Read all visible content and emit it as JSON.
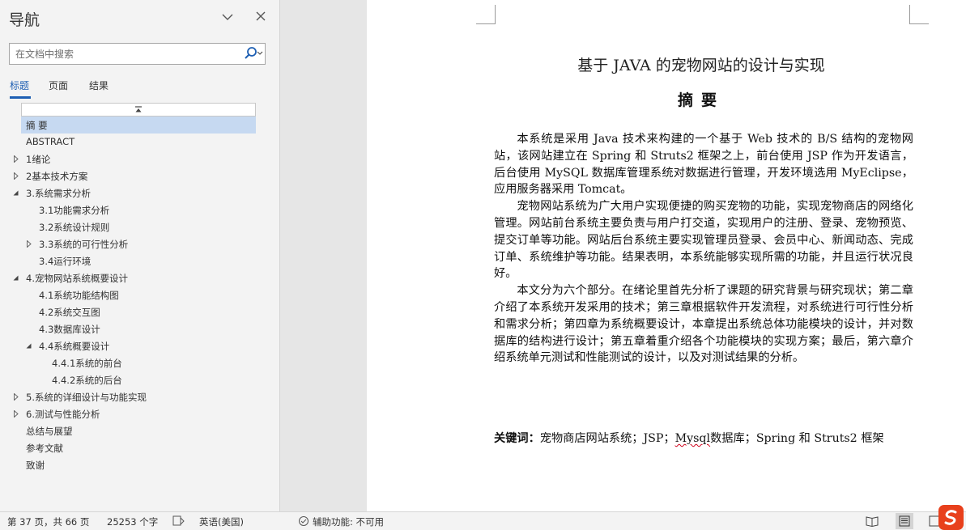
{
  "nav": {
    "title": "导航",
    "search_placeholder": "在文档中搜索",
    "tabs": [
      "标题",
      "页面",
      "结果"
    ],
    "active_tab": "标题",
    "headings": [
      {
        "label": "摘 要",
        "level": 1,
        "toggle": "none",
        "selected": true
      },
      {
        "label": "ABSTRACT",
        "level": 1,
        "toggle": "none",
        "selected": false
      },
      {
        "label": "1绪论",
        "level": 1,
        "toggle": "collapsed",
        "selected": false
      },
      {
        "label": "2基本技术方案",
        "level": 1,
        "toggle": "collapsed",
        "selected": false
      },
      {
        "label": "3.系统需求分析",
        "level": 1,
        "toggle": "expanded",
        "selected": false
      },
      {
        "label": "3.1功能需求分析",
        "level": 2,
        "toggle": "none",
        "selected": false
      },
      {
        "label": "3.2系统设计规则",
        "level": 2,
        "toggle": "none",
        "selected": false
      },
      {
        "label": "3.3系统的可行性分析",
        "level": 2,
        "toggle": "collapsed",
        "selected": false
      },
      {
        "label": "3.4运行环境",
        "level": 2,
        "toggle": "none",
        "selected": false
      },
      {
        "label": "4.宠物网站系统概要设计",
        "level": 1,
        "toggle": "expanded",
        "selected": false
      },
      {
        "label": "4.1系统功能结构图",
        "level": 2,
        "toggle": "none",
        "selected": false
      },
      {
        "label": "4.2系统交互图",
        "level": 2,
        "toggle": "none",
        "selected": false
      },
      {
        "label": "4.3数据库设计",
        "level": 2,
        "toggle": "none",
        "selected": false
      },
      {
        "label": "4.4系统概要设计",
        "level": 2,
        "toggle": "expanded",
        "selected": false
      },
      {
        "label": "4.4.1系统的前台",
        "level": 3,
        "toggle": "none",
        "selected": false
      },
      {
        "label": "4.4.2系统的后台",
        "level": 3,
        "toggle": "none",
        "selected": false
      },
      {
        "label": "5.系统的详细设计与功能实现",
        "level": 1,
        "toggle": "collapsed",
        "selected": false
      },
      {
        "label": "6.测试与性能分析",
        "level": 1,
        "toggle": "collapsed",
        "selected": false
      },
      {
        "label": "总结与展望",
        "level": 1,
        "toggle": "none",
        "selected": false
      },
      {
        "label": "参考文献",
        "level": 1,
        "toggle": "none",
        "selected": false
      },
      {
        "label": "致谢",
        "level": 1,
        "toggle": "none",
        "selected": false
      }
    ]
  },
  "document": {
    "title": "基于 JAVA 的宠物网站的设计与实现",
    "subtitle": "摘要",
    "paragraphs": [
      "本系统是采用 Java 技术来构建的一个基于 Web 技术的 B/S 结构的宠物网站，该网站建立在 Spring 和 Struts2 框架之上，前台使用 JSP 作为开发语言，后台使用 MySQL 数据库管理系统对数据进行管理，开发环境选用 MyEclipse，应用服务器采用 Tomcat。",
      "宠物网站系统为广大用户实现便捷的购买宠物的功能，实现宠物商店的网络化管理。网站前台系统主要负责与用户打交道，实现用户的注册、登录、宠物预览、提交订单等功能。网站后台系统主要实现管理员登录、会员中心、新闻动态、完成订单、系统维护等功能。结果表明，本系统能够实现所需的功能，并且运行状况良好。",
      "本文分为六个部分。在绪论里首先分析了课题的研究背景与研究现状；第二章介绍了本系统开发采用的技术；第三章根据软件开发流程，对系统进行可行性分析和需求分析；第四章为系统概要设计，本章提出系统总体功能模块的设计，并对数据库的结构进行设计；第五章着重介绍各个功能模块的实现方案；最后，第六章介绍系统单元测试和性能测试的设计，以及对测试结果的分析。"
    ],
    "keywords_label": "关键词：",
    "keywords_part1": "宠物商店网站系统；JSP；",
    "keywords_misspelled": "Mysql",
    "keywords_part2": "数据库；Spring 和 Struts2 框架"
  },
  "status": {
    "page": "第 37 页，共 66 页",
    "words": "25253 个字",
    "language": "英语(美国)",
    "accessibility": "辅助功能: 不可用"
  },
  "colors": {
    "accent": "#1e5fb3",
    "selected_bg": "#c6d9f1",
    "logo_red": "#e8401c"
  }
}
